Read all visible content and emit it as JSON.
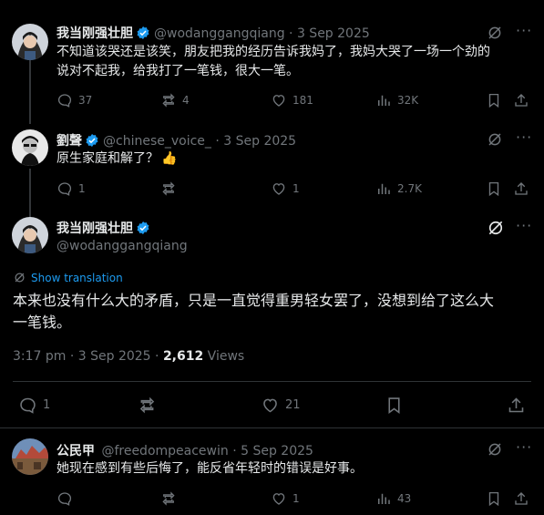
{
  "post1": {
    "name": "我当刚强壮胆",
    "handle": "@wodanggangqiang",
    "date": "3 Sep 2025",
    "text_line1": "不知道该哭还是该笑，朋友把我的经历告诉我妈了，我妈大哭了一场一个劲的",
    "text_line2": "说对不起我，给我打了一笔钱，很大一笔。",
    "replies": "37",
    "reposts": "4",
    "likes": "181",
    "views": "32K"
  },
  "post2": {
    "name": "劉聲",
    "handle": "@chinese_voice_",
    "date": "3 Sep 2025",
    "text": "原生家庭和解了？",
    "emoji": "👍",
    "replies": "1",
    "reposts": "",
    "likes": "1",
    "views": "2.7K"
  },
  "main": {
    "name": "我当刚强壮胆",
    "handle": "@wodanggangqiang",
    "translate_label": "Show translation",
    "text_line1": "本来也没有什么大的矛盾，只是一直觉得重男轻女罢了，没想到给了这么大",
    "text_line2": "一笔钱。",
    "time": "3:17 pm · 3 Sep 2025 · ",
    "views_count": "2,612",
    "views_label": " Views",
    "replies": "1",
    "reposts": "",
    "likes": "21"
  },
  "post3": {
    "name": "公民甲",
    "handle": "@freedompeacewin",
    "date": "5 Sep 2025",
    "text": "她现在感到有些后悔了，能反省年轻时的错误是好事。",
    "replies": "",
    "reposts": "",
    "likes": "1",
    "views": "43"
  },
  "separator": " · ",
  "colors": {
    "accent": "#1d9bf0",
    "muted": "#71767b",
    "text": "#e7e9ea",
    "border": "#2f3336"
  }
}
